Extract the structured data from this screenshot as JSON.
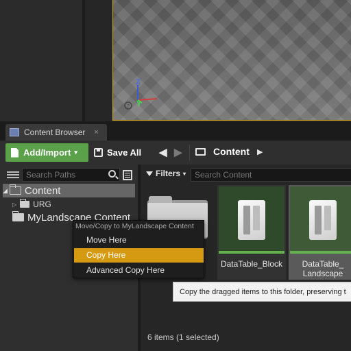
{
  "viewport": {
    "axis_labels": {
      "z": "Z",
      "y": "Y"
    }
  },
  "tab": {
    "title": "Content Browser",
    "close_glyph": "×"
  },
  "toolbar": {
    "add_import_label": "Add/Import",
    "add_import_caret": "▾",
    "save_all_label": "Save All",
    "back_glyph": "◀",
    "forward_glyph": "▶",
    "path_crumb": "Content",
    "path_arrow": "▶"
  },
  "sources": {
    "search_placeholder": "Search Paths",
    "tree": {
      "content_expander": "◢",
      "content_label": "Content",
      "urg_expander": "▷",
      "urg_label": "URG",
      "mylandscape_label": "MyLandscape Content"
    }
  },
  "assets": {
    "filters_label": "Filters",
    "filters_caret": "▾",
    "search_placeholder": "Search Content",
    "items": [
      {
        "label": "DataTable_Block"
      },
      {
        "label": "DataTable_ Landscape"
      }
    ],
    "status": "6 items (1 selected)"
  },
  "context_menu": {
    "heading": "Move/Copy to MyLandscape Content",
    "items": [
      "Move Here",
      "Copy Here",
      "Advanced Copy Here"
    ],
    "highlighted_index": 1
  },
  "tooltip": {
    "text": "Copy the dragged items to this folder, preserving t"
  },
  "colors": {
    "accent_highlight": "#d59a12",
    "add_import_green": "#5aa14a",
    "viewport_border": "#d4a017"
  }
}
